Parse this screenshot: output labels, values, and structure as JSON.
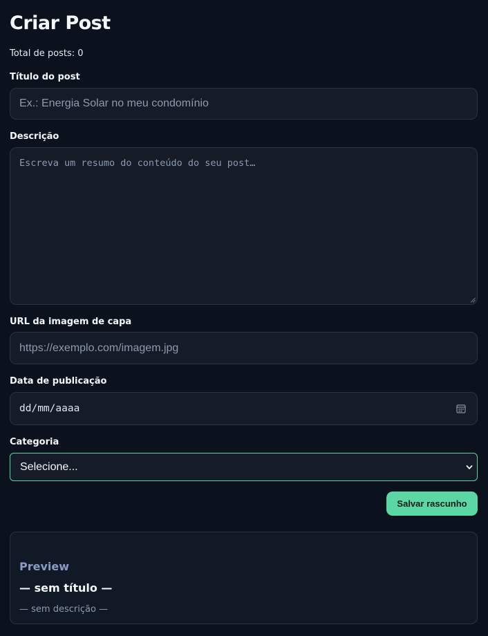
{
  "page": {
    "title": "Criar Post",
    "post_count": "Total de posts: 0"
  },
  "form": {
    "title_label": "Título do post",
    "title_placeholder": "Ex.: Energia Solar no meu condomínio",
    "description_label": "Descrição",
    "description_placeholder": "Escreva um resumo do conteúdo do seu post…",
    "cover_url_label": "URL da imagem de capa",
    "cover_url_placeholder": "https://exemplo.com/imagem.jpg",
    "publish_date_label": "Data de publicação",
    "publish_date_placeholder": "dd/mm/aaaa",
    "category_label": "Categoria",
    "category_selected": "Selecione...",
    "save_label": "Salvar rascunho"
  },
  "preview": {
    "heading": "Preview",
    "title": "— sem título —",
    "description": "— sem descrição —"
  },
  "colors": {
    "background": "#0b111d",
    "surface": "#151b27",
    "border": "#2b3442",
    "accent": "#5ad7a3",
    "preview_heading": "#8a9cc4"
  },
  "icons": {
    "date_picker": "calendar-icon",
    "select_arrow": "chevron-down-icon",
    "textarea_resize": "resize-grip-icon"
  }
}
